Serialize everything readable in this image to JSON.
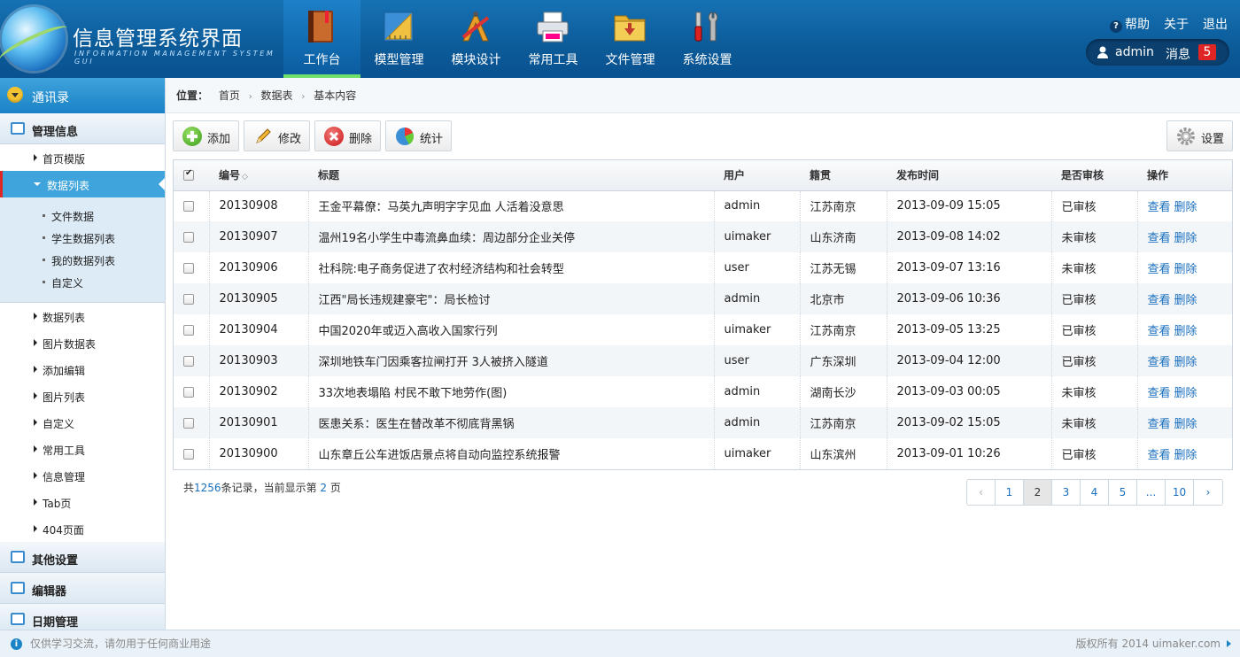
{
  "app": {
    "title": "信息管理系统界面",
    "subtitle": "INFORMATION MANAGEMENT SYSTEM GUI"
  },
  "topnav": [
    {
      "label": "工作台",
      "icon": "book-icon",
      "active": true
    },
    {
      "label": "模型管理",
      "icon": "ruler-icon",
      "active": false
    },
    {
      "label": "模块设计",
      "icon": "design-tools-icon",
      "active": false
    },
    {
      "label": "常用工具",
      "icon": "printer-icon",
      "active": false
    },
    {
      "label": "文件管理",
      "icon": "folder-icon",
      "active": false
    },
    {
      "label": "系统设置",
      "icon": "wrench-screwdriver-icon",
      "active": false
    }
  ],
  "toplinks": {
    "help": "帮助",
    "about": "关于",
    "logout": "退出"
  },
  "user": {
    "name": "admin",
    "messages_label": "消息",
    "message_count": "5"
  },
  "sidebar": {
    "header": "通讯录",
    "section_main": "管理信息",
    "sub1": [
      "首页模版"
    ],
    "active": "数据列表",
    "third": [
      "文件数据",
      "学生数据列表",
      "我的数据列表",
      "自定义"
    ],
    "sub2": [
      "数据列表",
      "图片数据表",
      "添加编辑",
      "图片列表",
      "自定义",
      "常用工具",
      "信息管理",
      "Tab页",
      "404页面"
    ],
    "sections": [
      "其他设置",
      "编辑器",
      "日期管理"
    ]
  },
  "breadcrumb": {
    "label": "位置：",
    "items": [
      "首页",
      "数据表",
      "基本内容"
    ]
  },
  "toolbar": {
    "add": "添加",
    "edit": "修改",
    "delete": "删除",
    "stats": "统计",
    "settings": "设置"
  },
  "table": {
    "headers": [
      "编号",
      "标题",
      "用户",
      "籍贯",
      "发布时间",
      "是否审核",
      "操作"
    ],
    "rows": [
      {
        "id": "20130908",
        "title": "王金平幕僚：马英九声明字字见血 人活着没意思",
        "user": "admin",
        "origin": "江苏南京",
        "time": "2013-09-09 15:05",
        "status": "已审核"
      },
      {
        "id": "20130907",
        "title": "温州19名小学生中毒流鼻血续：周边部分企业关停",
        "user": "uimaker",
        "origin": "山东济南",
        "time": "2013-09-08 14:02",
        "status": "未审核"
      },
      {
        "id": "20130906",
        "title": "社科院:电子商务促进了农村经济结构和社会转型",
        "user": "user",
        "origin": "江苏无锡",
        "time": "2013-09-07 13:16",
        "status": "未审核"
      },
      {
        "id": "20130905",
        "title": "江西\"局长违规建豪宅\"：局长检讨",
        "user": "admin",
        "origin": "北京市",
        "time": "2013-09-06 10:36",
        "status": "已审核"
      },
      {
        "id": "20130904",
        "title": "中国2020年或迈入高收入国家行列",
        "user": "uimaker",
        "origin": "江苏南京",
        "time": "2013-09-05 13:25",
        "status": "已审核"
      },
      {
        "id": "20130903",
        "title": "深圳地铁车门因乘客拉闸打开 3人被挤入隧道",
        "user": "user",
        "origin": "广东深圳",
        "time": "2013-09-04 12:00",
        "status": "已审核"
      },
      {
        "id": "20130902",
        "title": "33次地表塌陷 村民不敢下地劳作(图)",
        "user": "admin",
        "origin": "湖南长沙",
        "time": "2013-09-03 00:05",
        "status": "未审核"
      },
      {
        "id": "20130901",
        "title": "医患关系：医生在替改革不彻底背黑锅",
        "user": "admin",
        "origin": "江苏南京",
        "time": "2013-09-02 15:05",
        "status": "未审核"
      },
      {
        "id": "20130900",
        "title": "山东章丘公车进饭店景点将自动向监控系统报警",
        "user": "uimaker",
        "origin": "山东滨州",
        "time": "2013-09-01 10:26",
        "status": "已审核"
      }
    ],
    "view": "查看",
    "del": "删除"
  },
  "summary": {
    "prefix": "共",
    "total": "1256",
    "mid": "条记录，当前显示第",
    "page": "2",
    "suffix": "页"
  },
  "pager": {
    "prev": "‹",
    "pages": [
      "1",
      "2",
      "3",
      "4",
      "5",
      "...",
      "10"
    ],
    "current": "2",
    "next": "›"
  },
  "footer": {
    "left": "仅供学习交流，请勿用于任何商业用途",
    "right": "版权所有 2014 uimaker.com"
  }
}
